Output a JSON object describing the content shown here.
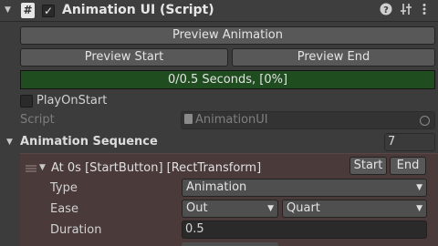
{
  "header": {
    "script_glyph": "#",
    "enabled_check": "✓",
    "title": "Animation UI (Script)",
    "help_icon": "help-icon",
    "presets_icon": "sliders-icon",
    "menu_icon": "kebab-menu-icon"
  },
  "buttons": {
    "preview_animation": "Preview Animation",
    "preview_start": "Preview Start",
    "preview_end": "Preview End"
  },
  "progress": {
    "text": "0/0.5 Seconds, [0%]",
    "fraction": 0
  },
  "play_on_start": {
    "label": "PlayOnStart",
    "checked": false
  },
  "script_field": {
    "label": "Script",
    "value": "AnimationUI"
  },
  "sequence": {
    "label": "Animation Sequence",
    "count": "7"
  },
  "element": {
    "title": "At 0s [StartButton] [RectTransform]",
    "start_label": "Start",
    "end_label": "End",
    "type_label": "Type",
    "type_value": "Animation",
    "ease_label": "Ease",
    "ease_mode": "Out",
    "ease_curve": "Quart",
    "duration_label": "Duration",
    "duration_value": "0.5"
  },
  "colors": {
    "progress_fill": "#1f4d1f",
    "element_bg": "#4a3a3a"
  }
}
